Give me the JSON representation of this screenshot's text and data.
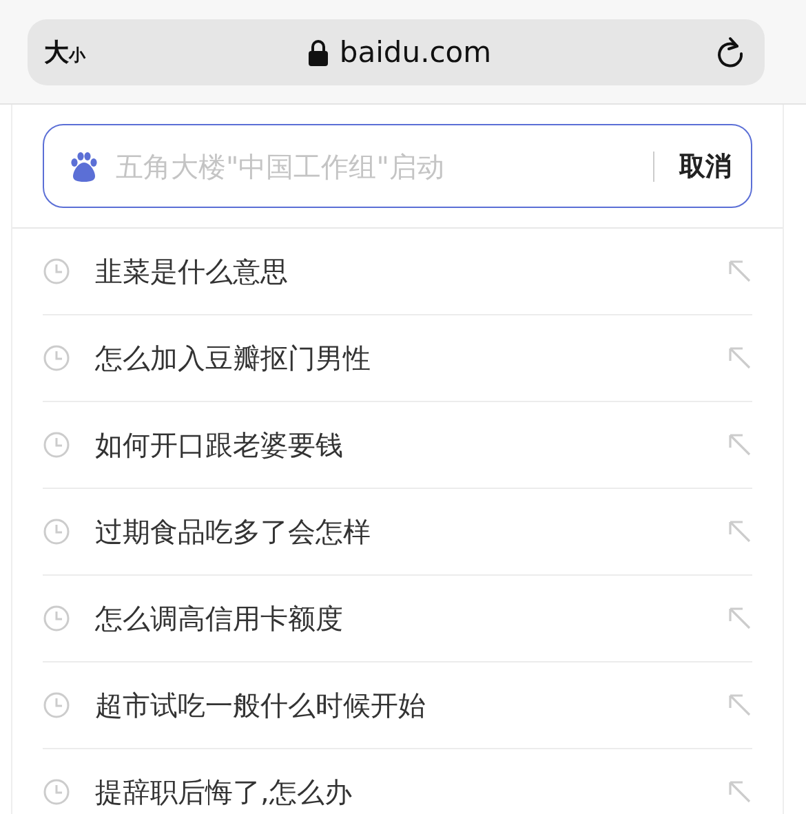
{
  "address_bar": {
    "text_size_large": "大",
    "text_size_small": "小",
    "url": "baidu.com"
  },
  "search": {
    "placeholder": "五角大楼\"中国工作组\"启动",
    "cancel": "取消"
  },
  "history": [
    {
      "text": "韭菜是什么意思"
    },
    {
      "text": "怎么加入豆瓣抠门男性"
    },
    {
      "text": "如何开口跟老婆要钱"
    },
    {
      "text": "过期食品吃多了会怎样"
    },
    {
      "text": "怎么调高信用卡额度"
    },
    {
      "text": "超市试吃一般什么时候开始"
    },
    {
      "text": "提辞职后悔了,怎么办"
    }
  ]
}
